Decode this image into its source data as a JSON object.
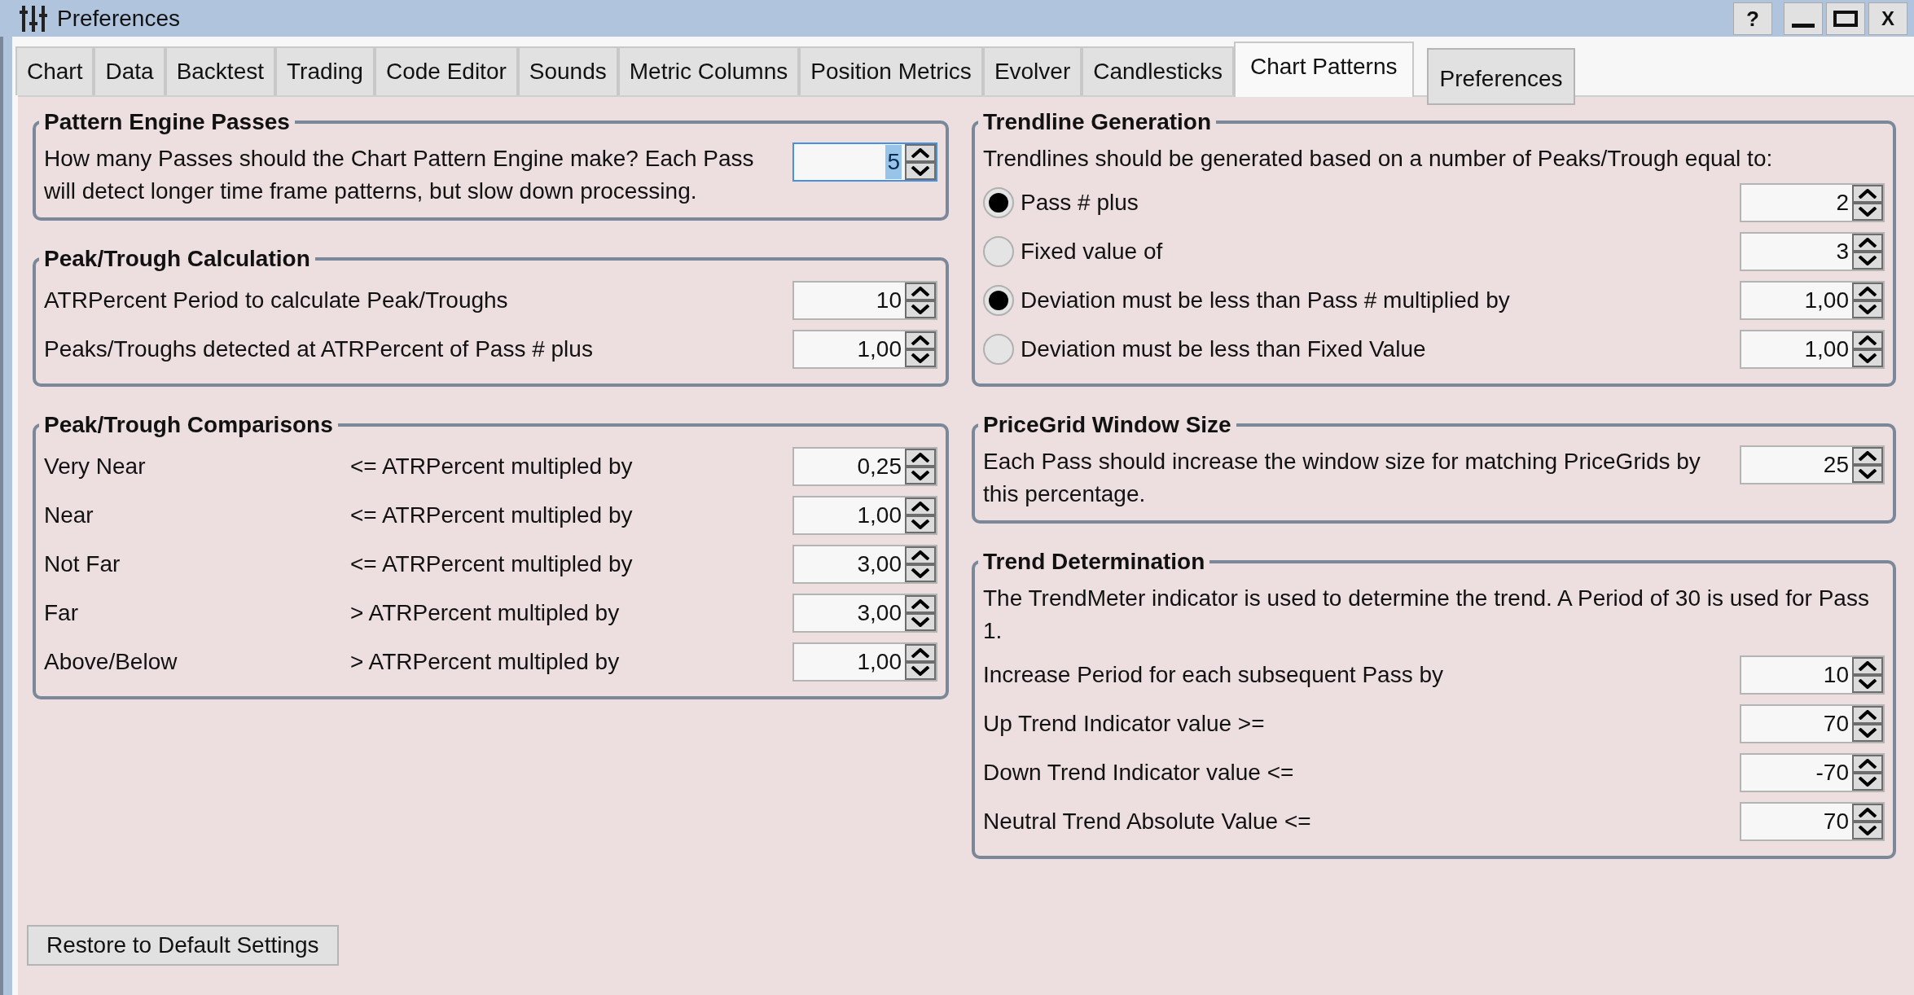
{
  "window": {
    "title": "Preferences",
    "help_button": "?",
    "close_button": "X"
  },
  "tabs": [
    {
      "label": "Chart",
      "selected": false
    },
    {
      "label": "Data",
      "selected": false
    },
    {
      "label": "Backtest",
      "selected": false
    },
    {
      "label": "Trading",
      "selected": false
    },
    {
      "label": "Code Editor",
      "selected": false
    },
    {
      "label": "Sounds",
      "selected": false
    },
    {
      "label": "Metric Columns",
      "selected": false
    },
    {
      "label": "Position Metrics",
      "selected": false
    },
    {
      "label": "Evolver",
      "selected": false
    },
    {
      "label": "Candlesticks",
      "selected": false
    },
    {
      "label": "Chart Patterns",
      "selected": true
    }
  ],
  "preferences_button": "Preferences",
  "left_groups": [
    {
      "title": "Pattern Engine Passes",
      "rows": [
        {
          "kind": "text",
          "label": "How many Passes should the Chart Pattern Engine make? Each Pass will detect longer time frame patterns, but slow down processing.",
          "value": "5",
          "focused": true
        }
      ]
    },
    {
      "title": "Peak/Trough Calculation",
      "rows": [
        {
          "kind": "text",
          "label": "ATRPercent Period to calculate Peak/Troughs",
          "value": "10",
          "focused": false
        },
        {
          "kind": "text",
          "label": "Peaks/Troughs detected at ATRPercent of Pass # plus",
          "value": "1,00",
          "focused": false
        }
      ]
    },
    {
      "title": "Peak/Trough Comparisons",
      "rows": [
        {
          "kind": "compare",
          "label": "Very Near",
          "comparison": "<= ATRPercent multipled by",
          "value": "0,25",
          "focused": false
        },
        {
          "kind": "compare",
          "label": "Near",
          "comparison": "<= ATRPercent multipled by",
          "value": "1,00",
          "focused": false
        },
        {
          "kind": "compare",
          "label": "Not Far",
          "comparison": "<= ATRPercent multipled by",
          "value": "3,00",
          "focused": false
        },
        {
          "kind": "compare",
          "label": "Far",
          "comparison": "> ATRPercent multipled by",
          "value": "3,00",
          "focused": false
        },
        {
          "kind": "compare",
          "label": "Above/Below",
          "comparison": "> ATRPercent multipled by",
          "value": "1,00",
          "focused": false
        }
      ]
    }
  ],
  "right_groups": [
    {
      "title": "Trendline Generation",
      "note": "Trendlines should be generated based on a number of Peaks/Trough equal to:",
      "rows": [
        {
          "kind": "radio",
          "label": "Pass # plus",
          "selected": true,
          "value": "2",
          "focused": false
        },
        {
          "kind": "radio",
          "label": "Fixed value of",
          "selected": false,
          "value": "3",
          "focused": false
        },
        {
          "kind": "radio",
          "label": "Deviation must be less than Pass # multiplied by",
          "selected": true,
          "value": "1,00",
          "focused": false
        },
        {
          "kind": "radio",
          "label": "Deviation must be less than Fixed Value",
          "selected": false,
          "value": "1,00",
          "focused": false
        }
      ]
    },
    {
      "title": "PriceGrid Window Size",
      "rows": [
        {
          "kind": "text",
          "label": "Each Pass should increase the window size for matching PriceGrids by this percentage.",
          "value": "25",
          "focused": false
        }
      ]
    },
    {
      "title": "Trend Determination",
      "note": "The TrendMeter indicator is used to determine the trend. A Period of 30 is used for Pass 1.",
      "rows": [
        {
          "kind": "text",
          "label": "Increase Period for each subsequent Pass by",
          "value": "10",
          "focused": false
        },
        {
          "kind": "text",
          "label": "Up Trend Indicator value >=",
          "value": "70",
          "focused": false
        },
        {
          "kind": "text",
          "label": "Down Trend Indicator value <=",
          "value": "-70",
          "focused": false
        },
        {
          "kind": "text",
          "label": "Neutral Trend Absolute Value <=",
          "value": "70",
          "focused": false
        }
      ]
    }
  ],
  "restore_button": "Restore to Default Settings"
}
